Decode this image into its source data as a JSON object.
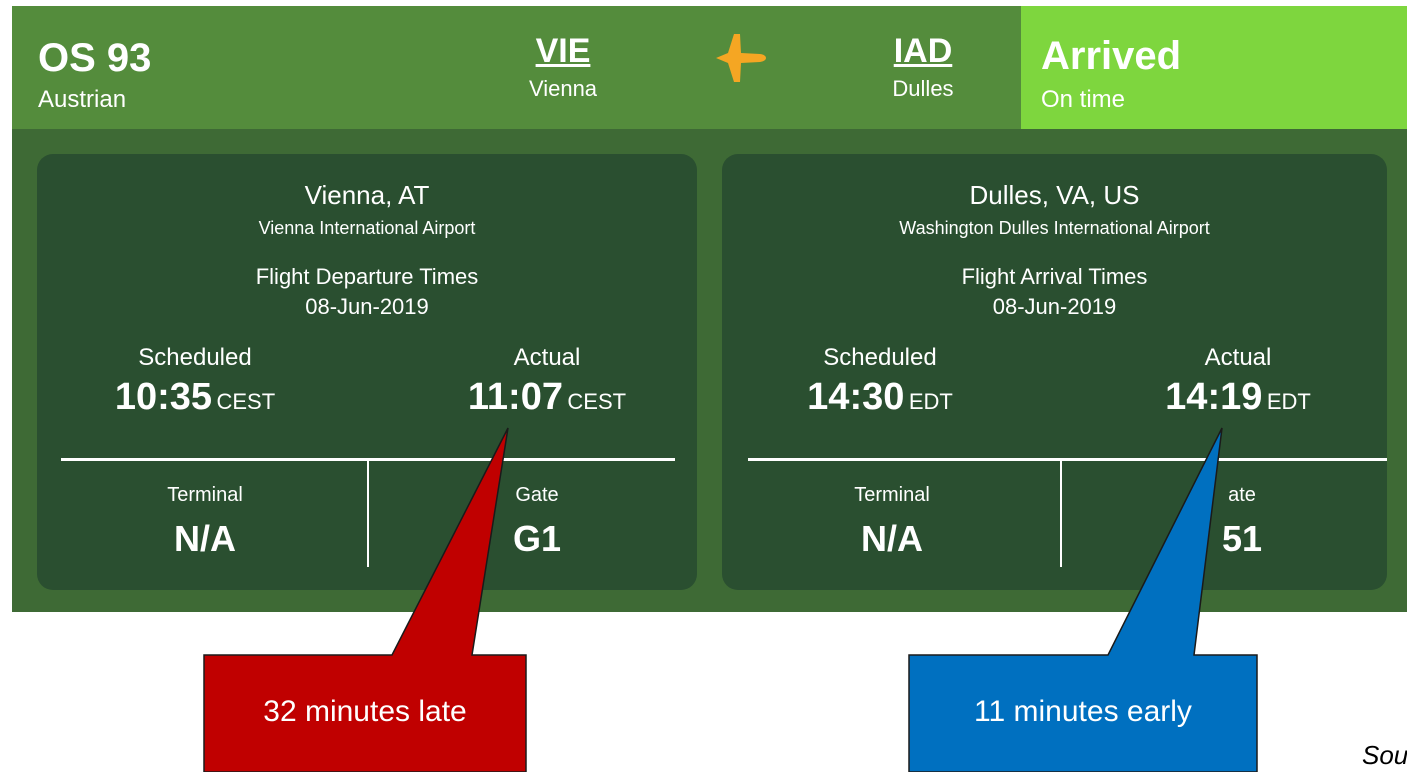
{
  "header": {
    "flight_number": "OS 93",
    "airline": "Austrian",
    "origin": {
      "code": "VIE",
      "name": "Vienna"
    },
    "destination": {
      "code": "IAD",
      "name": "Dulles"
    },
    "plane_icon": "airplane-icon",
    "status": {
      "title": "Arrived",
      "subtitle": "On time"
    }
  },
  "departure": {
    "city": "Vienna, AT",
    "airport": "Vienna International Airport",
    "times_title": "Flight Departure Times",
    "date": "08-Jun-2019",
    "scheduled_label": "Scheduled",
    "scheduled_time": "10:35",
    "scheduled_tz": "CEST",
    "actual_label": "Actual",
    "actual_time": "11:07",
    "actual_tz": "CEST",
    "terminal_label": "Terminal",
    "terminal": "N/A",
    "gate_label": "Gate",
    "gate": "G1"
  },
  "arrival": {
    "city": "Dulles, VA, US",
    "airport": "Washington Dulles International Airport",
    "times_title": "Flight Arrival Times",
    "date": "08-Jun-2019",
    "scheduled_label": "Scheduled",
    "scheduled_time": "14:30",
    "scheduled_tz": "EDT",
    "actual_label": "Actual",
    "actual_time": "14:19",
    "actual_tz": "EDT",
    "terminal_label": "Terminal",
    "terminal": "N/A",
    "gate_label": "ate",
    "gate": "51"
  },
  "callouts": {
    "late": {
      "text": "32 minutes late",
      "color": "#c00000"
    },
    "early": {
      "text": "11 minutes early",
      "color": "#0070c0"
    }
  },
  "source_text": "Sou",
  "colors": {
    "header_bg": "#548c3c",
    "panel_bg": "#3e6a35",
    "card_bg": "#2a4f30",
    "status_bg": "#7ed63e",
    "plane_icon": "#f5a623"
  }
}
